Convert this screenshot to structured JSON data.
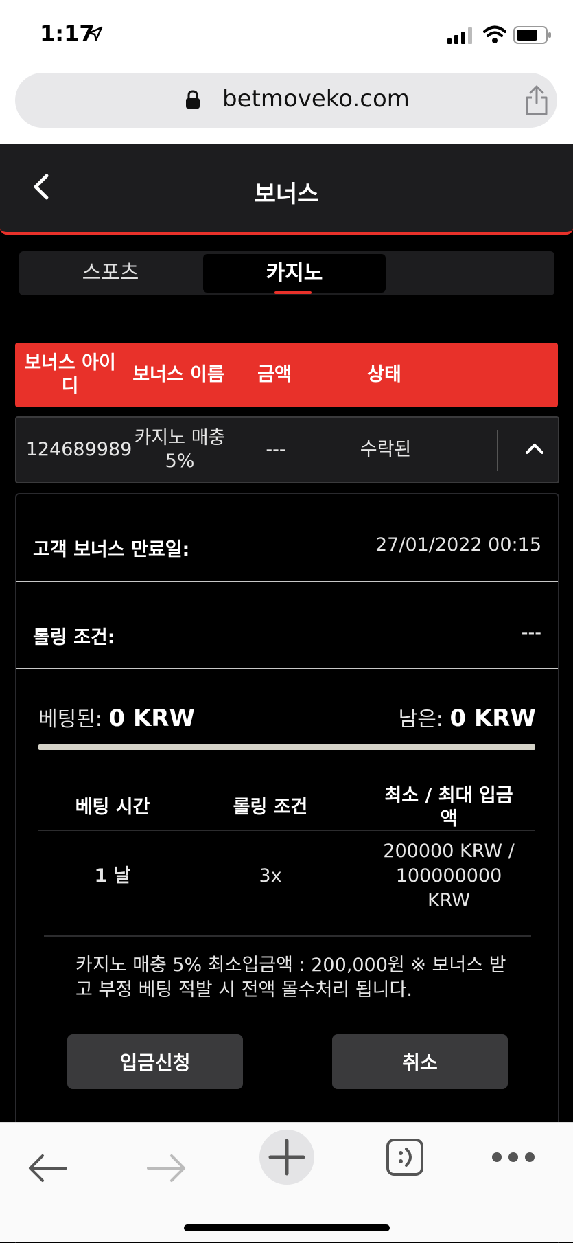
{
  "status_bar": {
    "time": "1:17"
  },
  "browser": {
    "url": "betmoveko.com"
  },
  "header": {
    "title": "보너스"
  },
  "tabs": [
    {
      "label": "스포츠",
      "active": false
    },
    {
      "label": "카지노",
      "active": true
    }
  ],
  "table": {
    "headers": [
      "보너스 아이디",
      "보너스 이름",
      "금액",
      "상태"
    ],
    "row": {
      "bonus_id": "124689989",
      "bonus_name": "카지노 매충 5%",
      "amount": "---",
      "status": "수락된"
    }
  },
  "detail": {
    "expiry_label": "고객 보너스 만료일:",
    "expiry_value": "27/01/2022 00:15",
    "rolling_label": "롤링 조건:",
    "rolling_value": "---",
    "bet_label": "베팅된:",
    "bet_value": "0 KRW",
    "remaining_label": "남은:",
    "remaining_value": "0 KRW",
    "progress_percent": 0,
    "inner_headers": [
      "베팅 시간",
      "롤링 조건",
      "최소 / 최대 입금액"
    ],
    "inner_row": [
      "1 날",
      "3x",
      "200000 KRW / 100000000 KRW"
    ],
    "note": "카지노 매충 5% 최소입금액 : 200,000원 ※ 보너스 받고 부정 베팅 적발 시 전액 몰수처리 됩니다.",
    "deposit_button": "입금신청",
    "cancel_button": "취소"
  },
  "colors": {
    "accent": "#e8312a",
    "background": "#000000",
    "surface": "#1d1d1f",
    "button": "#3a3a3c"
  }
}
